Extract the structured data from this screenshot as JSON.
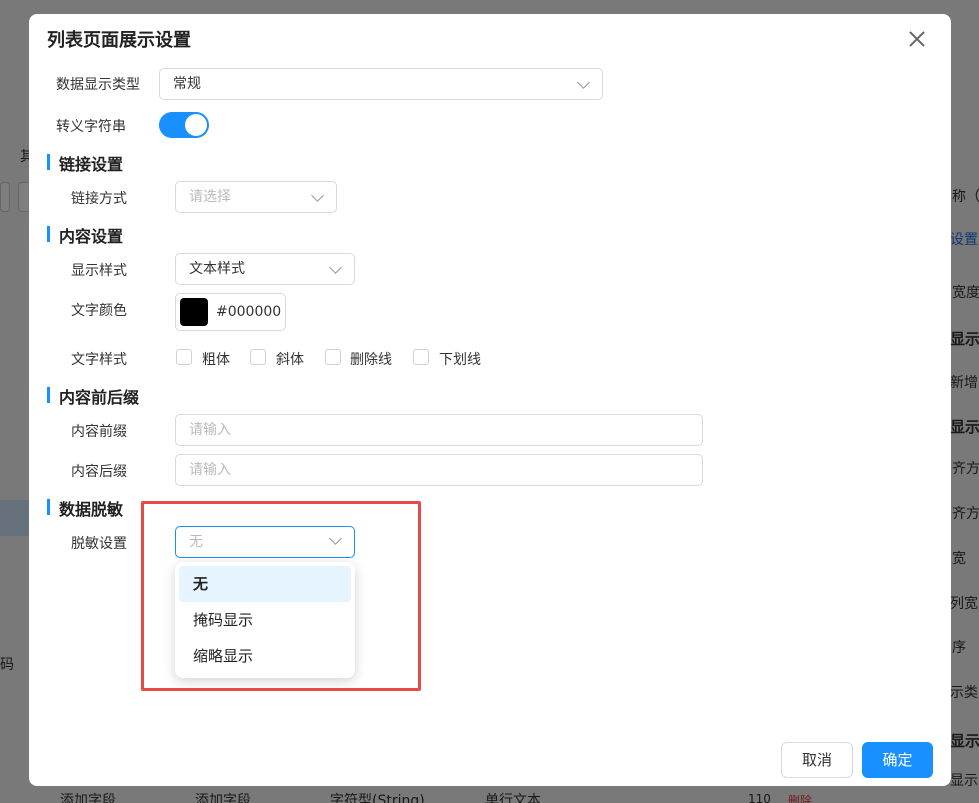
{
  "dialog": {
    "title": "列表页面展示设置",
    "fields": {
      "data_display_type": {
        "label": "数据显示类型",
        "value": "常规"
      },
      "escape_string": {
        "label": "转义字符串",
        "on": true
      }
    },
    "link_section": {
      "title": "链接设置",
      "link_method": {
        "label": "链接方式",
        "placeholder": "请选择"
      }
    },
    "content_section": {
      "title": "内容设置",
      "display_style": {
        "label": "显示样式",
        "value": "文本样式"
      },
      "text_color": {
        "label": "文字颜色",
        "value": "#000000"
      },
      "text_style": {
        "label": "文字样式",
        "options": [
          "粗体",
          "斜体",
          "删除线",
          "下划线"
        ]
      }
    },
    "affix_section": {
      "title": "内容前后缀",
      "prefix": {
        "label": "内容前缀",
        "placeholder": "请输入"
      },
      "suffix": {
        "label": "内容后缀",
        "placeholder": "请输入"
      }
    },
    "desensitize_section": {
      "title": "数据脱敏",
      "setting": {
        "label": "脱敏设置",
        "value": "无",
        "options": [
          "无",
          "掩码显示",
          "缩略显示"
        ],
        "selected_index": 0
      }
    },
    "buttons": {
      "cancel": "取消",
      "ok": "确定"
    }
  },
  "background": {
    "left_fragments": [
      "其",
      "码"
    ],
    "right_fragments": [
      "称（",
      "设置",
      "宽度",
      "显示",
      "新增",
      "显示",
      "齐方",
      "齐方",
      "宽",
      "列宽",
      "序",
      "示类",
      "显示",
      "显示"
    ],
    "bottom_fragments": [
      "添加字段",
      "添加字段",
      "字符型(String)",
      "单行文本",
      "110",
      "删除"
    ]
  },
  "colors": {
    "accent": "#1890ff",
    "highlight": "#e84a4a"
  }
}
